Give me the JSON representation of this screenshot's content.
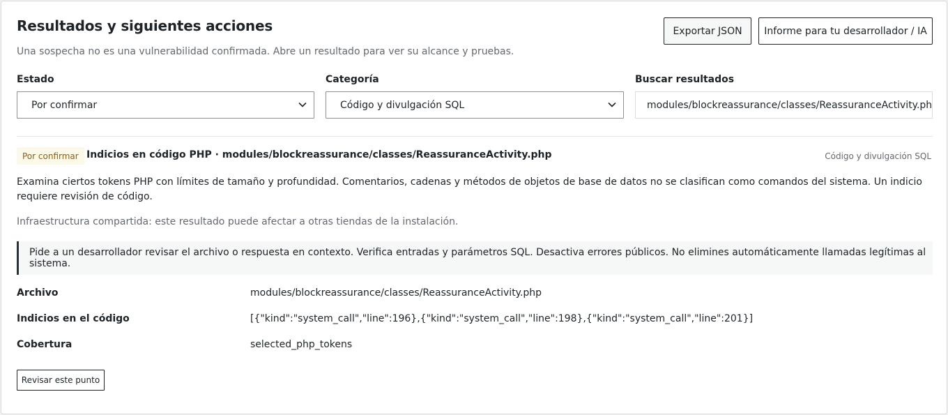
{
  "header": {
    "title": "Resultados y siguientes acciones",
    "subtitle": "Una sospecha no es una vulnerabilidad confirmada. Abre un resultado para ver su alcance y pruebas.",
    "export_label": "Exportar JSON",
    "report_label": "Informe para tu desarrollador / IA"
  },
  "filters": {
    "status_label": "Estado",
    "status_value": "Por confirmar",
    "category_label": "Categoría",
    "category_value": "Código y divulgación SQL",
    "search_label": "Buscar resultados",
    "search_value": "modules/blockreassurance/classes/ReassuranceActivity.php"
  },
  "result": {
    "badge": "Por confirmar",
    "title": "Indicios en código PHP · modules/blockreassurance/classes/ReassuranceActivity.php",
    "category": "Código y divulgación SQL",
    "description": "Examina ciertos tokens PHP con límites de tamaño y profundidad. Comentarios, cadenas y métodos de objetos de base de datos no se clasifican como comandos del sistema. Un indicio requiere revisión de código.",
    "shared_note": "Infraestructura compartida: este resultado puede afectar a otras tiendas de la instalación.",
    "notice": "Pide a un desarrollador revisar el archivo o respuesta en contexto. Verifica entradas y parámetros SQL. Desactiva errores públicos. No elimines automáticamente llamadas legítimas al sistema.",
    "details": [
      {
        "label": "Archivo",
        "value": "modules/blockreassurance/classes/ReassuranceActivity.php"
      },
      {
        "label": "Indicios en el código",
        "value": "[{\"kind\":\"system_call\",\"line\":196},{\"kind\":\"system_call\",\"line\":198},{\"kind\":\"system_call\",\"line\":201}]"
      },
      {
        "label": "Cobertura",
        "value": "selected_php_tokens"
      }
    ],
    "review_label": "Revisar este punto"
  },
  "icons": {
    "status_select": "chevron-down-icon",
    "category_select": "chevron-down-icon"
  }
}
